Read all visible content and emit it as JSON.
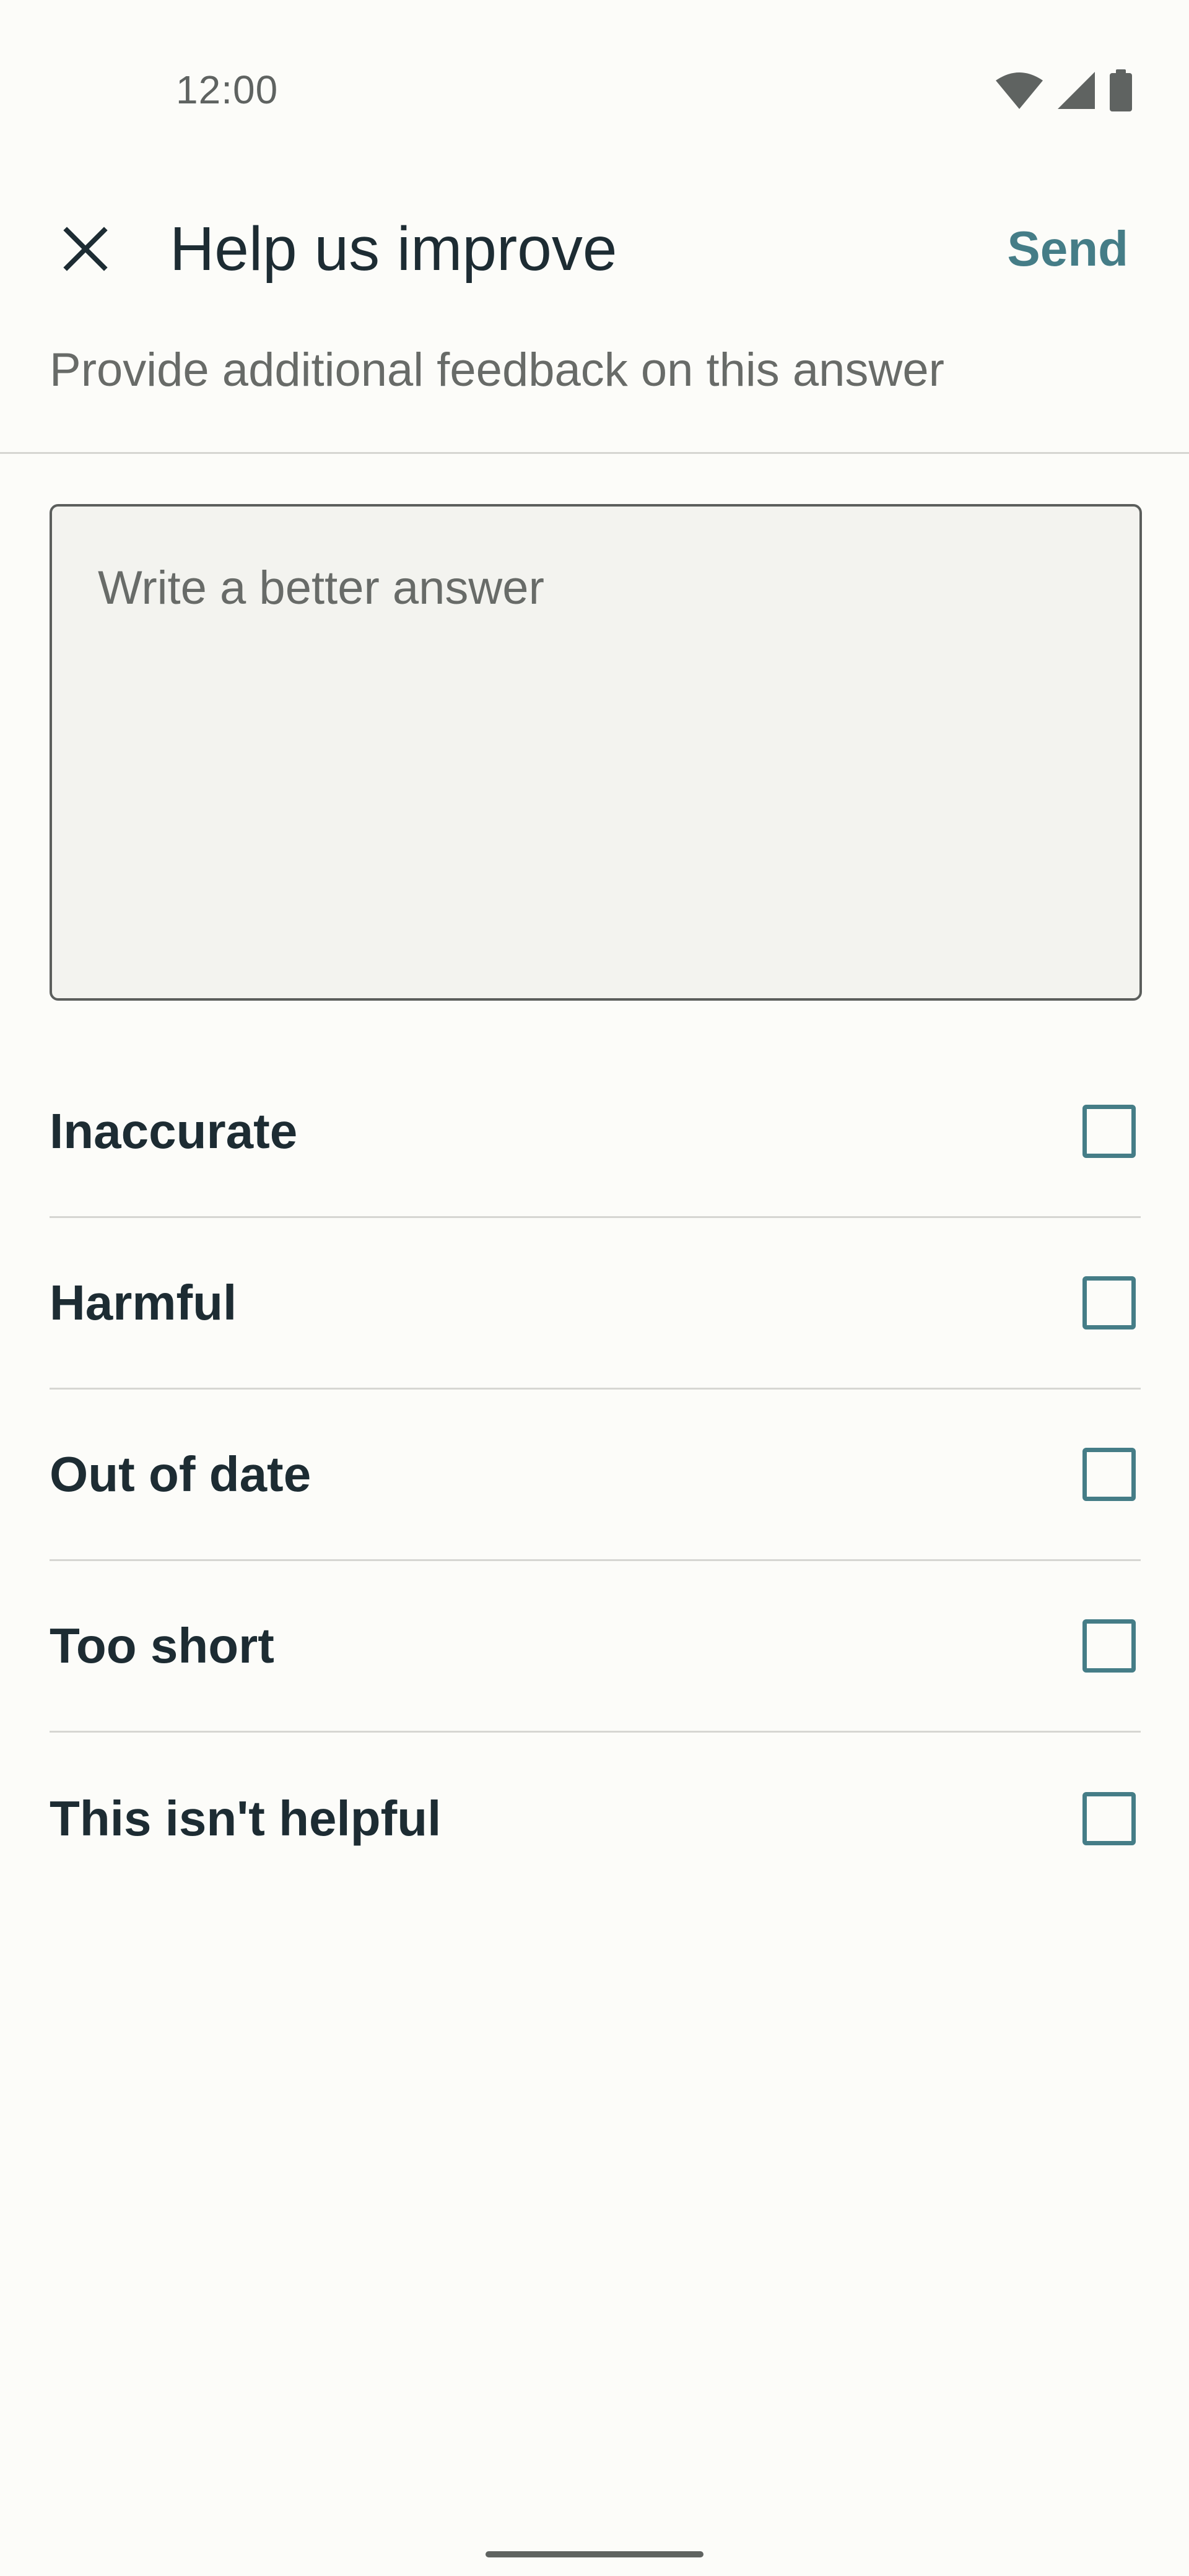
{
  "status_bar": {
    "time": "12:00",
    "icons": [
      "wifi-icon",
      "cellular-signal-icon",
      "battery-icon"
    ]
  },
  "app_bar": {
    "close_icon": "close-icon",
    "title": "Help us improve",
    "send_label": "Send"
  },
  "subtitle": "Provide additional feedback on this answer",
  "feedback_input": {
    "placeholder": "Write a better answer",
    "value": ""
  },
  "options": [
    {
      "label": "Inaccurate",
      "checked": false
    },
    {
      "label": "Harmful",
      "checked": false
    },
    {
      "label": "Out of date",
      "checked": false
    },
    {
      "label": "Too short",
      "checked": false
    },
    {
      "label": "This isn't helpful",
      "checked": false
    }
  ],
  "colors": {
    "background": "#fcfcf9",
    "accent": "#457d87",
    "text_primary": "#1d2c33",
    "text_secondary": "#686b68"
  }
}
